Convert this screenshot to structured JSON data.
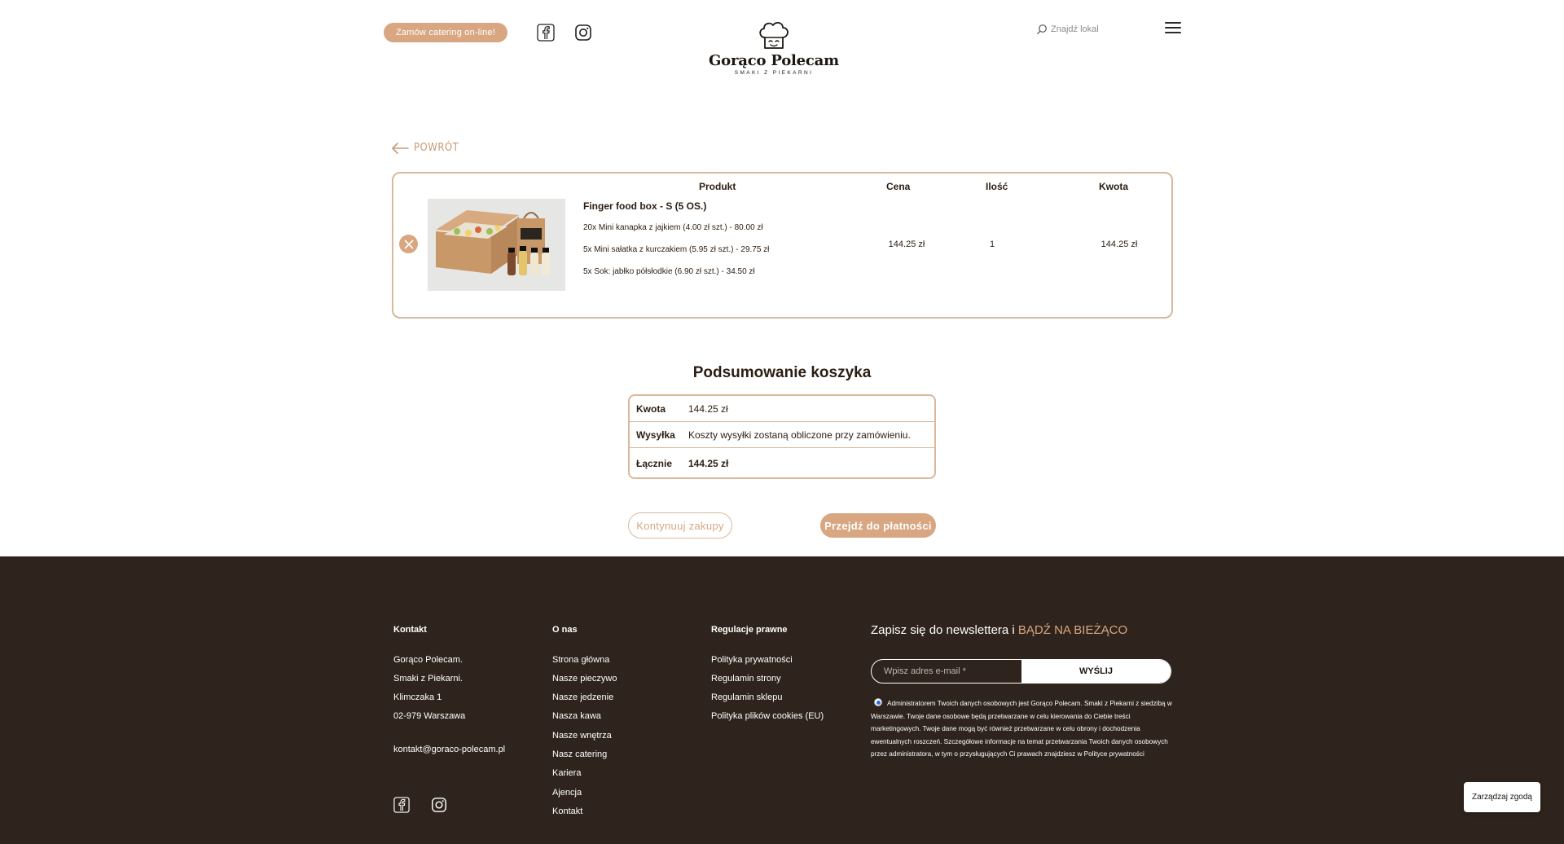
{
  "header": {
    "catering_button": "Zamów catering on-line!",
    "logo_name": "Gorąco Polecam",
    "logo_sub": "SMAKI Z PIEKARNI",
    "search_placeholder": "Znajdź lokal"
  },
  "back_label": "POWRÓT",
  "cart": {
    "columns": [
      "Produkt",
      "Cena",
      "Ilość",
      "Kwota"
    ],
    "item": {
      "title": "Finger food box - S (5 OS.)",
      "lines": [
        "20x Mini kanapka z jajkiem (4.00 zł szt.) - 80.00 zł",
        "5x Mini sałatka z kurczakiem (5.95 zł szt.) - 29.75 zł",
        "5x Sok: jabłko półsłodkie (6.90 zł szt.) - 34.50 zł"
      ],
      "price": "144.25 zł",
      "quantity": "1",
      "amount": "144.25 zł"
    }
  },
  "summary": {
    "title": "Podsumowanie koszyka",
    "rows": [
      {
        "label": "Kwota",
        "value": "144.25 zł"
      },
      {
        "label": "Wysyłka",
        "value": "Koszty wysyłki zostaną obliczone przy zamówieniu."
      },
      {
        "label": "Łącznie",
        "value": "144.25 zł"
      }
    ]
  },
  "buttons": {
    "continue": "Kontynuuj zakupy",
    "checkout": "Przejdź do płatności"
  },
  "footer": {
    "contact": {
      "title": "Kontakt",
      "lines": [
        "Gorąco Polecam.",
        "Smaki z Piekarni.",
        "Klimczaka 1",
        "02-979 Warszawa"
      ],
      "email": "kontakt@goraco-polecam.pl"
    },
    "about": {
      "title": "O nas",
      "links": [
        "Strona główna",
        "Nasze pieczywo",
        "Nasze jedzenie",
        "Nasza kawa",
        "Nasze wnętrza",
        "Nasz catering",
        "Kariera",
        "Ajencja",
        "Kontakt"
      ]
    },
    "legal": {
      "title": "Regulacje prawne",
      "links": [
        "Polityka prywatności",
        "Regulamin strony",
        "Regulamin sklepu",
        "Polityka plików cookies (EU)"
      ]
    },
    "newsletter": {
      "title": "Zapisz się do newslettera i",
      "highlight": "BĄDŹ NA BIEŻĄCO",
      "email_placeholder": "Wpisz adres e-mail *",
      "send": "WYŚLIJ",
      "consent": "Administratorem Twoich danych osobowych jest Gorąco Polecam. Smaki z Piekarni z siedzibą w Warszawie. Twoje dane osobowe będą przetwarzane w celu kierowania do Ciebie treści marketingowych. Twoje dane mogą być również przetwarzane w celu obrony i dochodzenia ewentualnych roszczeń. Szczegółowe informacje na temat przetwarzania Twoich danych osobowych przez administratora, w tym o przysługujących Ci prawach znajdziesz w Polityce prywatności"
    }
  },
  "consent_manager": "Zarządzaj zgodą",
  "colors": {
    "accent": "#d9a682",
    "border": "#d9b89b",
    "footer_bg": "#2e241d",
    "text": "#2b1d12"
  },
  "icons": [
    "facebook-icon",
    "instagram-icon",
    "chef-hat-logo-icon",
    "search-icon",
    "hamburger-menu-icon",
    "arrow-left-icon",
    "remove-x-icon"
  ]
}
